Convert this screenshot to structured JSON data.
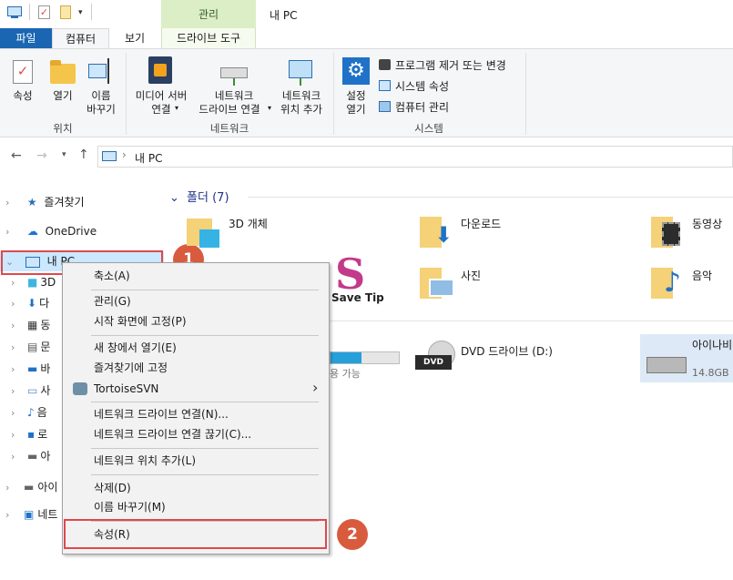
{
  "window": {
    "title": "내 PC"
  },
  "ribbon": {
    "context_tab": "관리",
    "tabs": [
      "파일",
      "컴퓨터",
      "보기",
      "드라이브 도구"
    ],
    "groups": {
      "location": {
        "label": "위치",
        "buttons": {
          "properties": "속성",
          "open": "열기",
          "rename_line1": "이름",
          "rename_line2": "바꾸기"
        }
      },
      "network": {
        "label": "네트워크",
        "buttons": {
          "media_line1": "미디어 서버",
          "media_line2": "연결",
          "map_line1": "네트워크",
          "map_line2": "드라이브 연결",
          "add_line1": "네트워크",
          "add_line2": "위치 추가"
        }
      },
      "system": {
        "label": "시스템",
        "settings_line1": "설정",
        "settings_line2": "열기",
        "uninstall": "프로그램 제거 또는 변경",
        "sysprops": "시스템 속성",
        "manage": "컴퓨터 관리"
      }
    }
  },
  "address": {
    "path": "내 PC"
  },
  "sidebar": {
    "favorites": "즐겨찾기",
    "onedrive": "OneDrive",
    "thispc": "내 PC",
    "sub_items": [
      "3D",
      "다",
      "동",
      "문",
      "바",
      "사",
      "음",
      "로",
      "아"
    ],
    "drive_aini": "아이",
    "network": "네트"
  },
  "content": {
    "folders_header": "폴더 (7)",
    "folders": [
      "3D 개체",
      "다운로드",
      "동영상",
      "사진",
      "음악"
    ],
    "watermark": "Save Tip",
    "devices": {
      "drive1_free_suffix": "용 가능",
      "drive1_fill_fraction": 0.45,
      "dvd": "DVD 드라이브 (D:)",
      "dvd_badge": "DVD",
      "drive3_name": "아이나비",
      "drive3_size": "14.8GB"
    }
  },
  "context_menu": {
    "items": [
      "축소(A)",
      "관리(G)",
      "시작 화면에 고정(P)",
      "새 창에서 열기(E)",
      "즐겨찾기에 고정",
      "TortoiseSVN",
      "네트워크 드라이브 연결(N)...",
      "네트워크 드라이브 연결 끊기(C)...",
      "네트워크 위치 추가(L)",
      "삭제(D)",
      "이름 바꾸기(M)",
      "속성(R)"
    ],
    "submenu_arrow": "›"
  },
  "callouts": {
    "one": "1",
    "two": "2"
  },
  "colors": {
    "accent": "#1a66b3",
    "callout": "#d95b3d",
    "highlight": "#e0484b",
    "manage_tab": "#dbeec6"
  }
}
